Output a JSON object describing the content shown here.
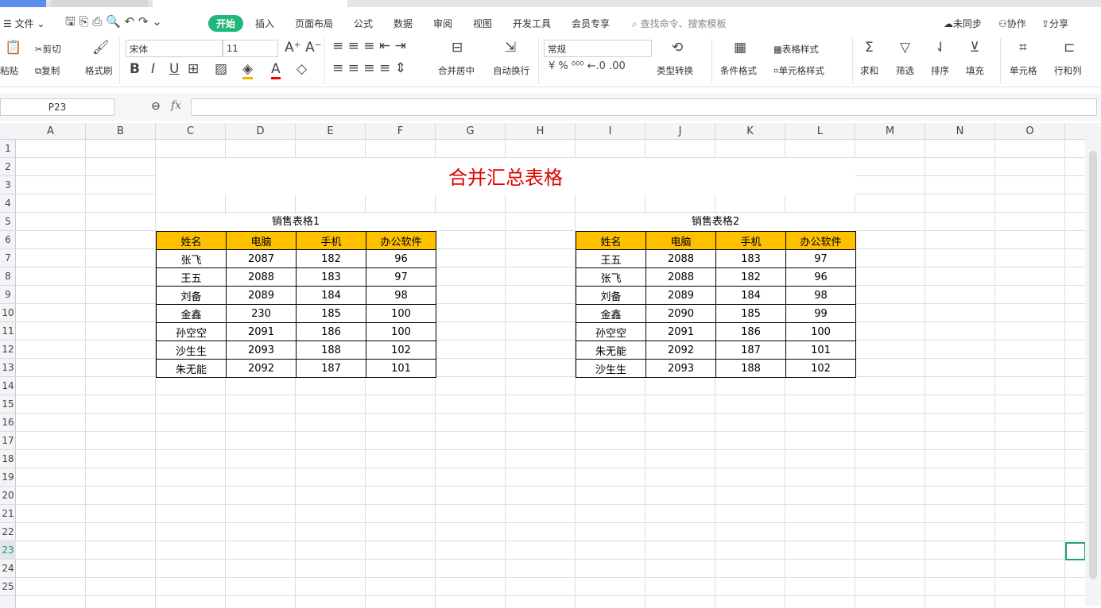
{
  "menu": {
    "file": "文件",
    "tabs": [
      "开始",
      "插入",
      "页面布局",
      "公式",
      "数据",
      "审阅",
      "视图",
      "开发工具",
      "会员专享"
    ],
    "search": "查找命令、搜索模板",
    "sync": "未同步",
    "collab": "协作",
    "share": "分享"
  },
  "ribbon": {
    "paste": "粘贴",
    "cut": "剪切",
    "copy": "复制",
    "format_painter": "格式刷",
    "font": "宋体",
    "size": "11",
    "merge": "合并居中",
    "wrap": "自动换行",
    "number_format": "常规",
    "convert": "类型转换",
    "cond_format": "条件格式",
    "table_style": "表格样式",
    "cell_style": "单元格样式",
    "sum": "求和",
    "filter": "筛选",
    "sort": "排序",
    "fill": "填充",
    "cell": "单元格",
    "rowcol": "行和列"
  },
  "formula": {
    "cell_ref": "P23",
    "fx": "fx",
    "value": ""
  },
  "columns": [
    "A",
    "B",
    "C",
    "D",
    "E",
    "F",
    "G",
    "H",
    "I",
    "J",
    "K",
    "L",
    "M",
    "N",
    "O"
  ],
  "rows": [
    "1",
    "2",
    "3",
    "4",
    "5",
    "6",
    "7",
    "8",
    "9",
    "10",
    "11",
    "12",
    "13",
    "14",
    "15",
    "16",
    "17",
    "18",
    "19",
    "20",
    "21",
    "22",
    "23",
    "24",
    "25"
  ],
  "sheet": {
    "title": "合并汇总表格",
    "table1": {
      "caption": "销售表格1",
      "headers": [
        "姓名",
        "电脑",
        "手机",
        "办公软件"
      ],
      "rows": [
        [
          "张飞",
          "2087",
          "182",
          "96"
        ],
        [
          "王五",
          "2088",
          "183",
          "97"
        ],
        [
          "刘备",
          "2089",
          "184",
          "98"
        ],
        [
          "金鑫",
          "230",
          "185",
          "100"
        ],
        [
          "孙空空",
          "2091",
          "186",
          "100"
        ],
        [
          "沙生生",
          "2093",
          "188",
          "102"
        ],
        [
          "朱无能",
          "2092",
          "187",
          "101"
        ]
      ]
    },
    "table2": {
      "caption": "销售表格2",
      "headers": [
        "姓名",
        "电脑",
        "手机",
        "办公软件"
      ],
      "rows": [
        [
          "王五",
          "2088",
          "183",
          "97"
        ],
        [
          "张飞",
          "2088",
          "182",
          "96"
        ],
        [
          "刘备",
          "2089",
          "184",
          "98"
        ],
        [
          "金鑫",
          "2090",
          "185",
          "99"
        ],
        [
          "孙空空",
          "2091",
          "186",
          "100"
        ],
        [
          "朱无能",
          "2092",
          "187",
          "101"
        ],
        [
          "沙生生",
          "2093",
          "188",
          "102"
        ]
      ]
    }
  }
}
